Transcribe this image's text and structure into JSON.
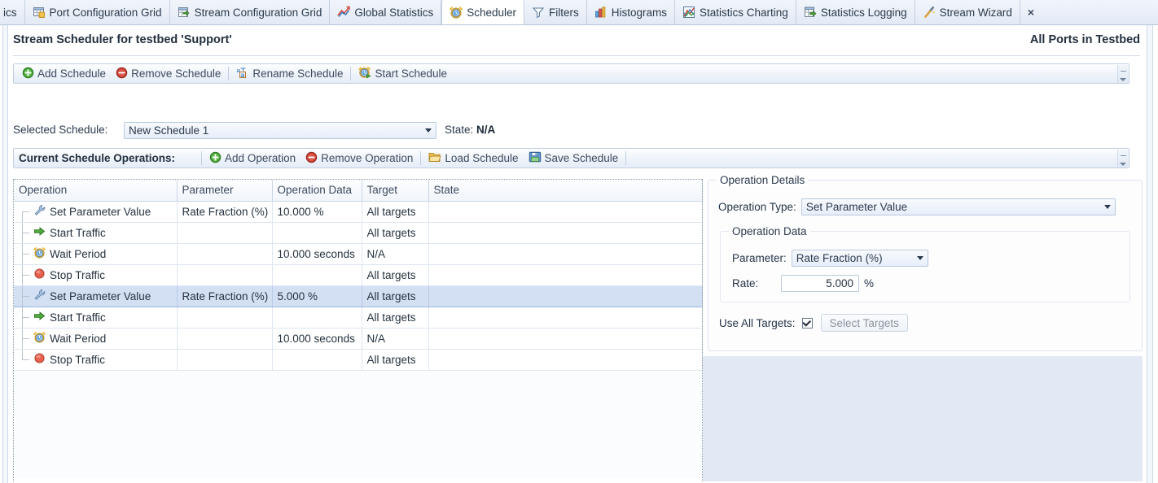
{
  "tabs": [
    {
      "label": "ics",
      "icon": "partial-tab",
      "active": false,
      "partial": true
    },
    {
      "label": "Port Configuration Grid",
      "icon": "grid-icon",
      "active": false
    },
    {
      "label": "Stream Configuration Grid",
      "icon": "stream-grid-icon",
      "active": false
    },
    {
      "label": "Global Statistics",
      "icon": "chart-line-icon",
      "active": false
    },
    {
      "label": "Scheduler",
      "icon": "clock-icon",
      "active": true
    },
    {
      "label": "Filters",
      "icon": "funnel-icon",
      "active": false
    },
    {
      "label": "Histograms",
      "icon": "bar-chart-icon",
      "active": false
    },
    {
      "label": "Statistics Charting",
      "icon": "chart-area-icon",
      "active": false
    },
    {
      "label": "Statistics Logging",
      "icon": "log-icon",
      "active": false
    },
    {
      "label": "Stream Wizard",
      "icon": "wand-icon",
      "active": false
    }
  ],
  "tab_close_label": "×",
  "page": {
    "title": "Stream Scheduler for testbed 'Support'",
    "subtitle": "All Ports in Testbed"
  },
  "schedule_toolbar": {
    "items": [
      {
        "label": "Add Schedule",
        "icon": "plus-circle-green-icon"
      },
      {
        "label": "Remove Schedule",
        "icon": "minus-circle-red-icon"
      },
      {
        "label": "Rename Schedule",
        "icon": "rename-icon"
      },
      {
        "label": "Start Schedule",
        "icon": "clock-play-icon"
      }
    ]
  },
  "selected_schedule": {
    "label": "Selected Schedule:",
    "value": "New Schedule 1",
    "state_label": "State:",
    "state_value": "N/A"
  },
  "operations_toolbar": {
    "label": "Current Schedule Operations:",
    "items": [
      {
        "label": "Add Operation",
        "icon": "plus-circle-green-icon"
      },
      {
        "label": "Remove Operation",
        "icon": "minus-circle-red-icon"
      },
      {
        "label": "Load Schedule",
        "icon": "folder-open-icon"
      },
      {
        "label": "Save Schedule",
        "icon": "floppy-save-icon"
      }
    ]
  },
  "grid": {
    "columns": [
      "Operation",
      "Parameter",
      "Operation Data",
      "Target",
      "State"
    ],
    "rows": [
      {
        "operation": "Set Parameter Value",
        "icon": "wrench-icon",
        "parameter": "Rate Fraction (%)",
        "operation_data": "10.000 %",
        "target": "All targets",
        "state": "",
        "selected": false
      },
      {
        "operation": "Start Traffic",
        "icon": "green-arrow-icon",
        "parameter": "",
        "operation_data": "",
        "target": "All targets",
        "state": "",
        "selected": false
      },
      {
        "operation": "Wait Period",
        "icon": "alarm-clock-icon",
        "parameter": "",
        "operation_data": "10.000 seconds",
        "target": "N/A",
        "state": "",
        "selected": false
      },
      {
        "operation": "Stop Traffic",
        "icon": "red-circle-icon",
        "parameter": "",
        "operation_data": "",
        "target": "All targets",
        "state": "",
        "selected": false
      },
      {
        "operation": "Set Parameter Value",
        "icon": "wrench-icon",
        "parameter": "Rate Fraction (%)",
        "operation_data": "5.000 %",
        "target": "All targets",
        "state": "",
        "selected": true
      },
      {
        "operation": "Start Traffic",
        "icon": "green-arrow-icon",
        "parameter": "",
        "operation_data": "",
        "target": "All targets",
        "state": "",
        "selected": false
      },
      {
        "operation": "Wait Period",
        "icon": "alarm-clock-icon",
        "parameter": "",
        "operation_data": "10.000 seconds",
        "target": "N/A",
        "state": "",
        "selected": false
      },
      {
        "operation": "Stop Traffic",
        "icon": "red-circle-icon",
        "parameter": "",
        "operation_data": "",
        "target": "All targets",
        "state": "",
        "selected": false
      }
    ]
  },
  "details": {
    "group_title": "Operation Details",
    "operation_type_label": "Operation Type:",
    "operation_type_value": "Set Parameter Value",
    "operation_data_title": "Operation Data",
    "parameter_label": "Parameter:",
    "parameter_value": "Rate Fraction (%)",
    "rate_label": "Rate:",
    "rate_value": "5.000",
    "rate_unit": "%",
    "use_all_targets_label": "Use All Targets:",
    "use_all_targets_checked": true,
    "select_targets_label": "Select Targets"
  },
  "colors": {
    "accent_selection": "#d3e0f4",
    "panel_blue": "#e2e8f4",
    "green": "#3f9a34",
    "red": "#cc3b33",
    "tab_border": "#c3cfe0"
  }
}
